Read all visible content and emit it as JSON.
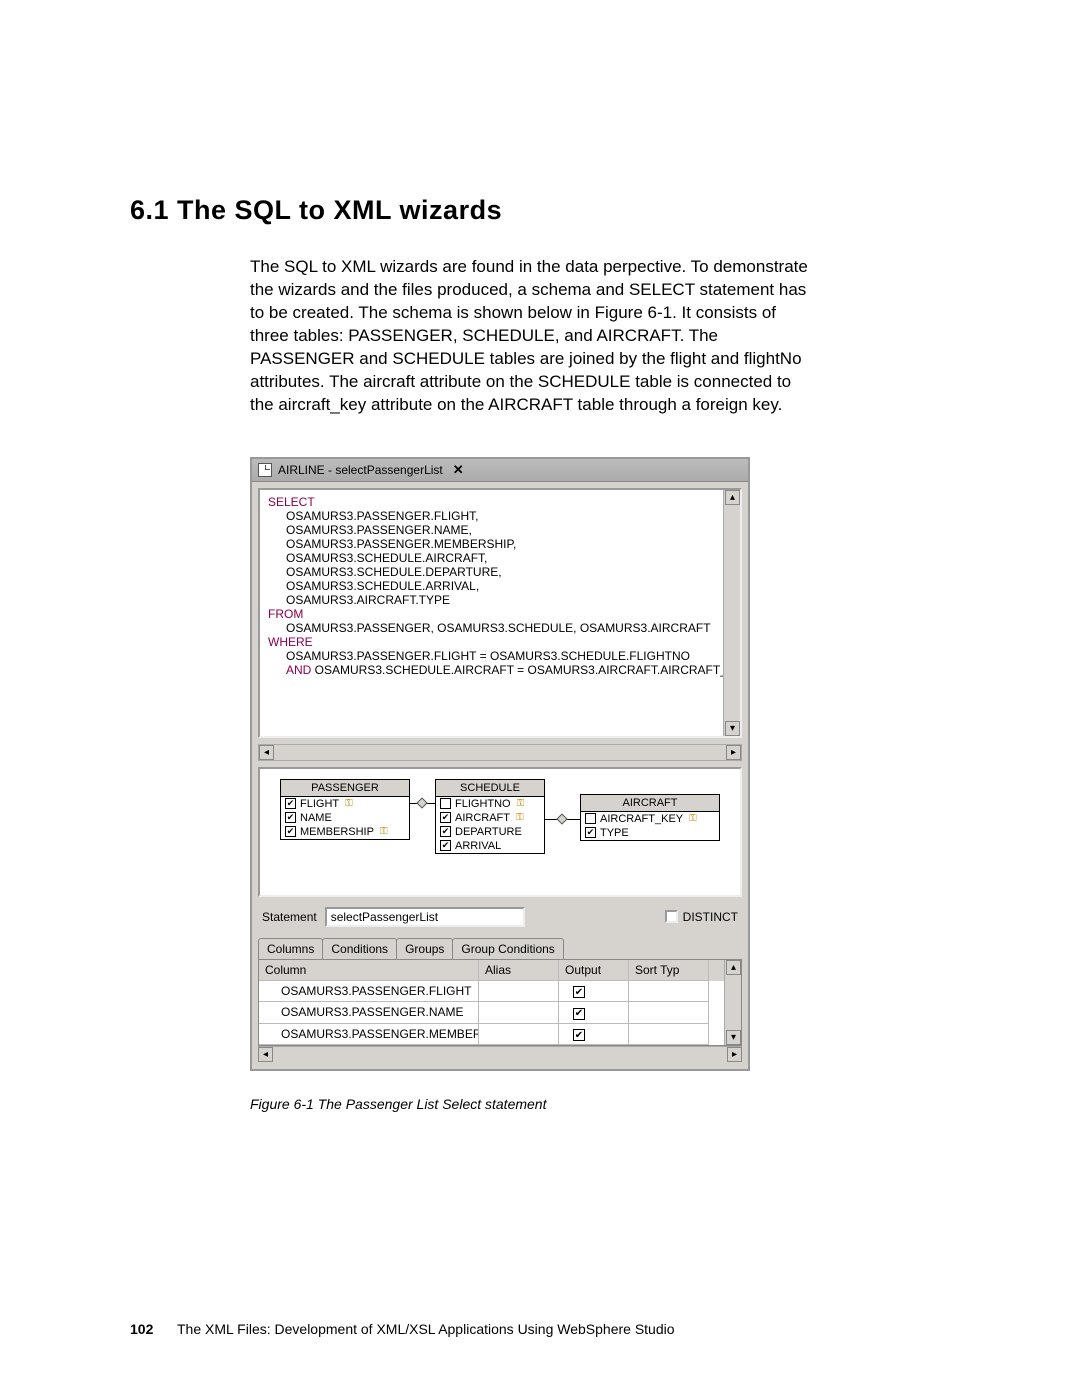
{
  "heading": "6.1  The SQL to XML wizards",
  "paragraph": "The SQL to XML wizards are found in the data perpective. To demonstrate the wizards and the files produced, a schema and SELECT statement has to be created. The schema is shown below in Figure 6-1. It consists of three tables: PASSENGER, SCHEDULE, and AIRCRAFT. The PASSENGER and SCHEDULE tables are joined by the flight and flightNo attributes. The aircraft attribute on the SCHEDULE table is connected to the aircraft_key attribute on the AIRCRAFT table through a foreign key.",
  "window_title": "AIRLINE - selectPassengerList",
  "sql": {
    "kw_select": "SELECT",
    "select_lines": [
      "OSAMURS3.PASSENGER.FLIGHT,",
      "OSAMURS3.PASSENGER.NAME,",
      "OSAMURS3.PASSENGER.MEMBERSHIP,",
      "OSAMURS3.SCHEDULE.AIRCRAFT,",
      "OSAMURS3.SCHEDULE.DEPARTURE,",
      "OSAMURS3.SCHEDULE.ARRIVAL,",
      "OSAMURS3.AIRCRAFT.TYPE"
    ],
    "kw_from": "FROM",
    "from_line": "OSAMURS3.PASSENGER, OSAMURS3.SCHEDULE, OSAMURS3.AIRCRAFT",
    "kw_where": "WHERE",
    "where_line1": "OSAMURS3.PASSENGER.FLIGHT = OSAMURS3.SCHEDULE.FLIGHTNO",
    "kw_and": "AND",
    "where_line2_rest": " OSAMURS3.SCHEDULE.AIRCRAFT = OSAMURS3.AIRCRAFT.AIRCRAFT_"
  },
  "tables": {
    "passenger": {
      "title": "PASSENGER",
      "rows": [
        {
          "checked": true,
          "label": "FLIGHT",
          "key": true
        },
        {
          "checked": true,
          "label": "NAME",
          "key": false
        },
        {
          "checked": true,
          "label": "MEMBERSHIP",
          "key": true
        }
      ]
    },
    "schedule": {
      "title": "SCHEDULE",
      "rows": [
        {
          "checked": false,
          "label": "FLIGHTNO",
          "key": true
        },
        {
          "checked": true,
          "label": "AIRCRAFT",
          "key": true
        },
        {
          "checked": true,
          "label": "DEPARTURE",
          "key": false
        },
        {
          "checked": true,
          "label": "ARRIVAL",
          "key": false
        }
      ]
    },
    "aircraft": {
      "title": "AIRCRAFT",
      "rows": [
        {
          "checked": false,
          "label": "AIRCRAFT_KEY",
          "key": true
        },
        {
          "checked": true,
          "label": "TYPE",
          "key": false
        }
      ]
    }
  },
  "statement_label": "Statement",
  "statement_value": "selectPassengerList",
  "distinct_label": "DISTINCT",
  "tabs": [
    "Columns",
    "Conditions",
    "Groups",
    "Group Conditions"
  ],
  "grid": {
    "headers": [
      "Column",
      "Alias",
      "Output",
      "Sort Typ"
    ],
    "rows": [
      {
        "column": "OSAMURS3.PASSENGER.FLIGHT",
        "alias": "",
        "output": true
      },
      {
        "column": "OSAMURS3.PASSENGER.NAME",
        "alias": "",
        "output": true
      },
      {
        "column": "OSAMURS3.PASSENGER.MEMBER…",
        "alias": "",
        "output": true
      }
    ]
  },
  "figure_caption": "Figure 6-1   The Passenger List Select statement",
  "footer_page": "102",
  "footer_text": "The XML Files:  Development of XML/XSL Applications Using WebSphere Studio"
}
